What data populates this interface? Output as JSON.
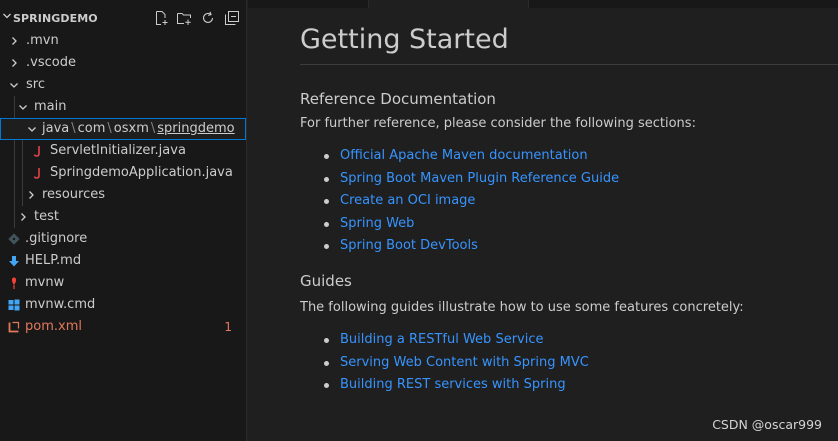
{
  "explorer": {
    "title": "SPRINGDEMO",
    "actions": [
      "new-file",
      "new-folder",
      "refresh",
      "collapse-all"
    ],
    "items": [
      {
        "label": ".mvn"
      },
      {
        "label": ".vscode"
      },
      {
        "label": "src"
      },
      {
        "label": "main"
      },
      {
        "segments": [
          "java",
          "com",
          "osxm",
          "springdemo"
        ],
        "separator": "\\"
      },
      {
        "label": "ServletInitializer.java"
      },
      {
        "label": "SpringdemoApplication.java"
      },
      {
        "label": "resources"
      },
      {
        "label": "test"
      },
      {
        "label": ".gitignore"
      },
      {
        "label": "HELP.md"
      },
      {
        "label": "mvnw"
      },
      {
        "label": "mvnw.cmd"
      },
      {
        "label": "pom.xml",
        "badge": "1"
      }
    ]
  },
  "preview": {
    "title": "Getting Started",
    "sections": [
      {
        "heading": "Reference Documentation",
        "intro": "For further reference, please consider the following sections:",
        "links": [
          "Official Apache Maven documentation",
          "Spring Boot Maven Plugin Reference Guide",
          "Create an OCI image",
          "Spring Web",
          "Spring Boot DevTools"
        ]
      },
      {
        "heading": "Guides",
        "intro": "The following guides illustrate how to use some features concretely:",
        "links": [
          "Building a RESTful Web Service",
          "Serving Web Content with Spring MVC",
          "Building REST services with Spring"
        ]
      }
    ]
  },
  "watermark": "CSDN @oscar999",
  "colors": {
    "sidebar_bg": "#181818",
    "editor_bg": "#1f1f1f",
    "link": "#3794ff",
    "modified": "#e2785c",
    "java_icon": "#e0434b",
    "selection_border": "#0078d4"
  }
}
